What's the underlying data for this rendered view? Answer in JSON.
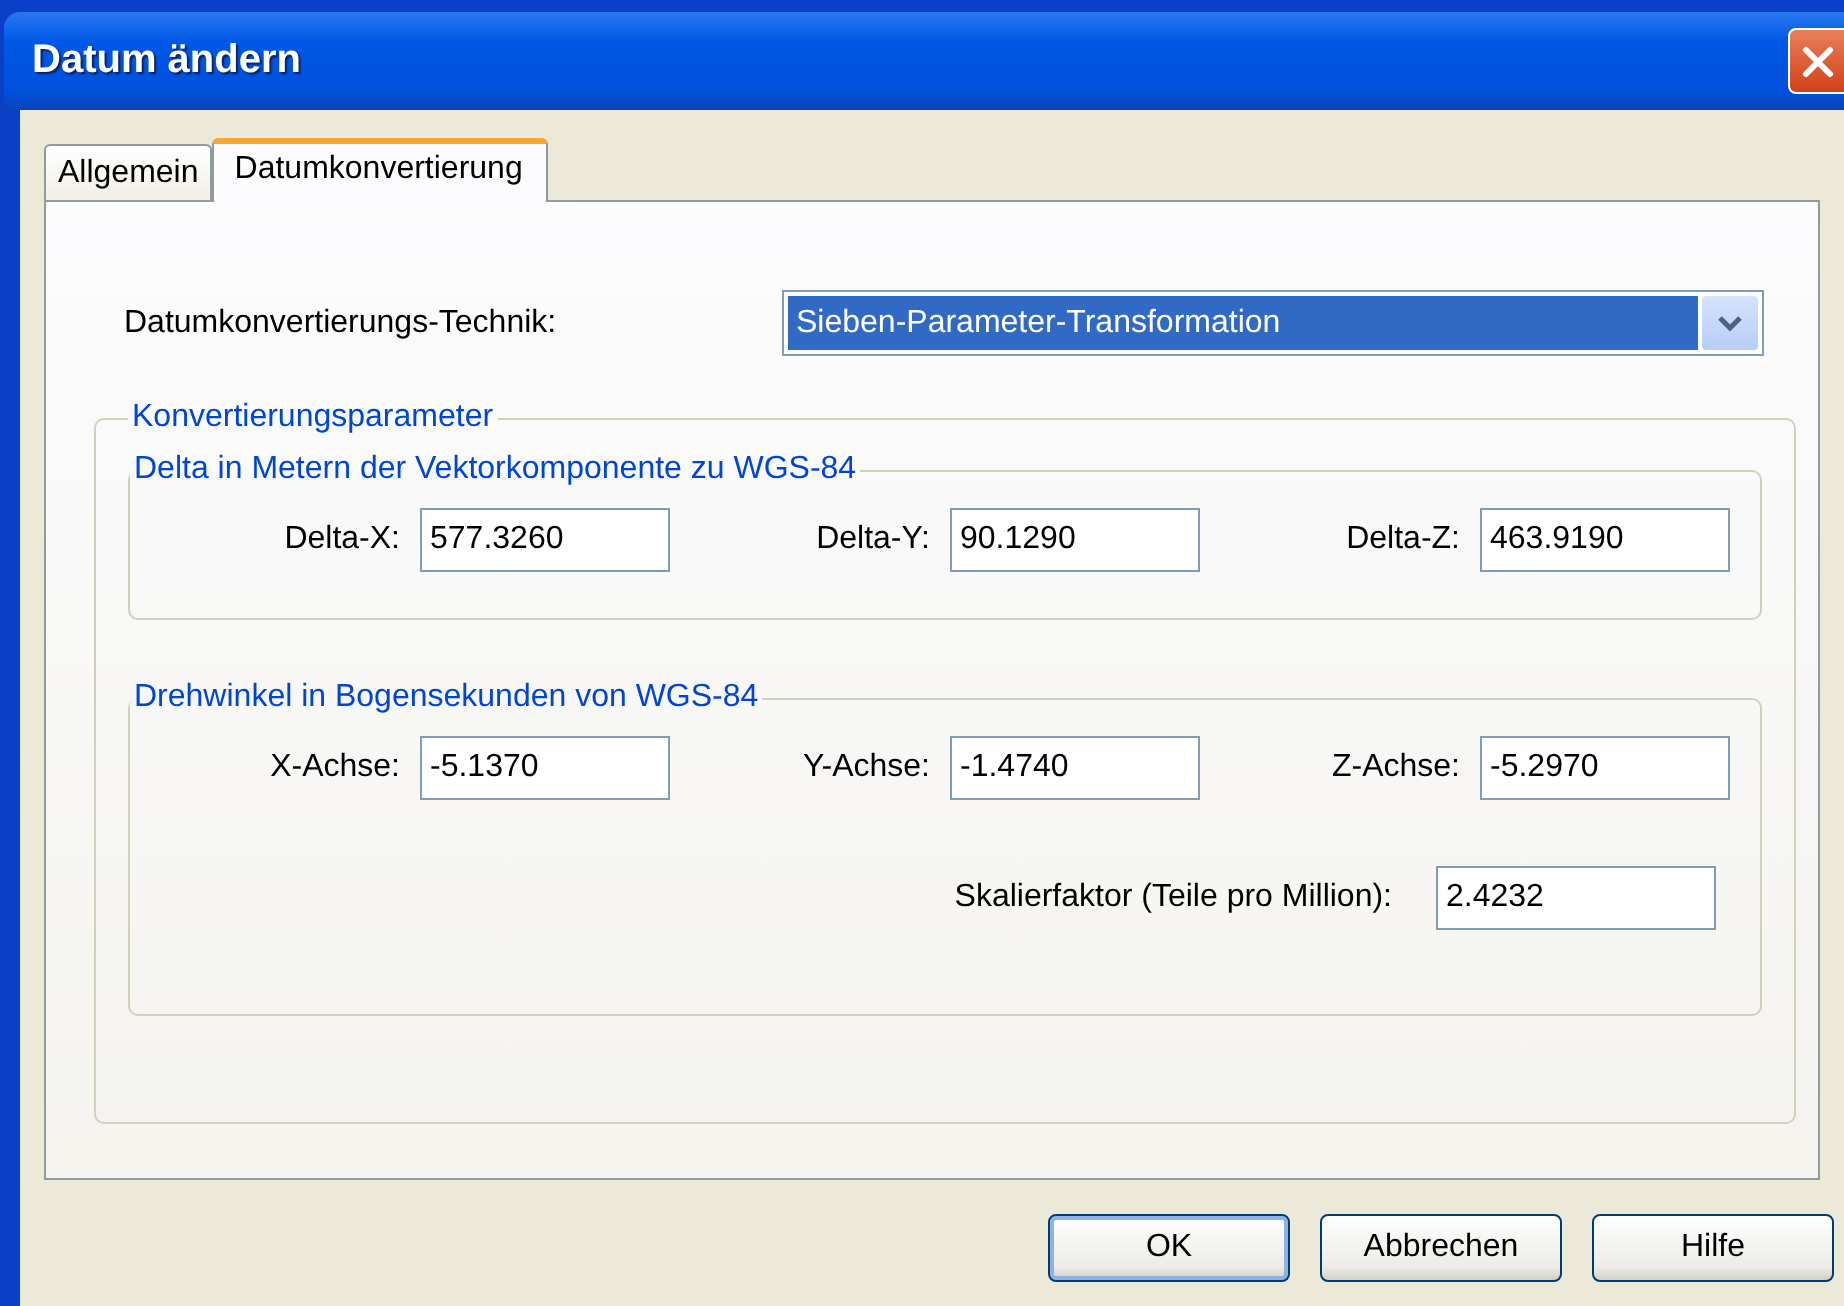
{
  "window": {
    "title": "Datum ändern"
  },
  "tabs": [
    {
      "label": "Allgemein",
      "selected": false
    },
    {
      "label": "Datumkonvertierung",
      "selected": true
    }
  ],
  "technique": {
    "label": "Datumkonvertierungs-Technik:",
    "value": "Sieben-Parameter-Transformation"
  },
  "parameters": {
    "title": "Konvertierungsparameter",
    "groups": [
      {
        "title": "Delta in Metern der Vektorkomponente zu WGS-84",
        "fields": [
          {
            "label": "Delta-X:",
            "value": "577.3260"
          },
          {
            "label": "Delta-Y:",
            "value": "90.1290"
          },
          {
            "label": "Delta-Z:",
            "value": "463.9190"
          }
        ]
      },
      {
        "title": "Drehwinkel in Bogensekunden von WGS-84",
        "fields": [
          {
            "label": "X-Achse:",
            "value": "-5.1370"
          },
          {
            "label": "Y-Achse:",
            "value": "-1.4740"
          },
          {
            "label": "Z-Achse:",
            "value": "-5.2970"
          }
        ],
        "scale": {
          "label": "Skalierfaktor (Teile pro Million):",
          "value": "2.4232"
        }
      }
    ]
  },
  "buttons": [
    {
      "label": "OK",
      "default": true
    },
    {
      "label": "Abbrechen",
      "default": false
    },
    {
      "label": "Hilfe",
      "default": false
    }
  ]
}
